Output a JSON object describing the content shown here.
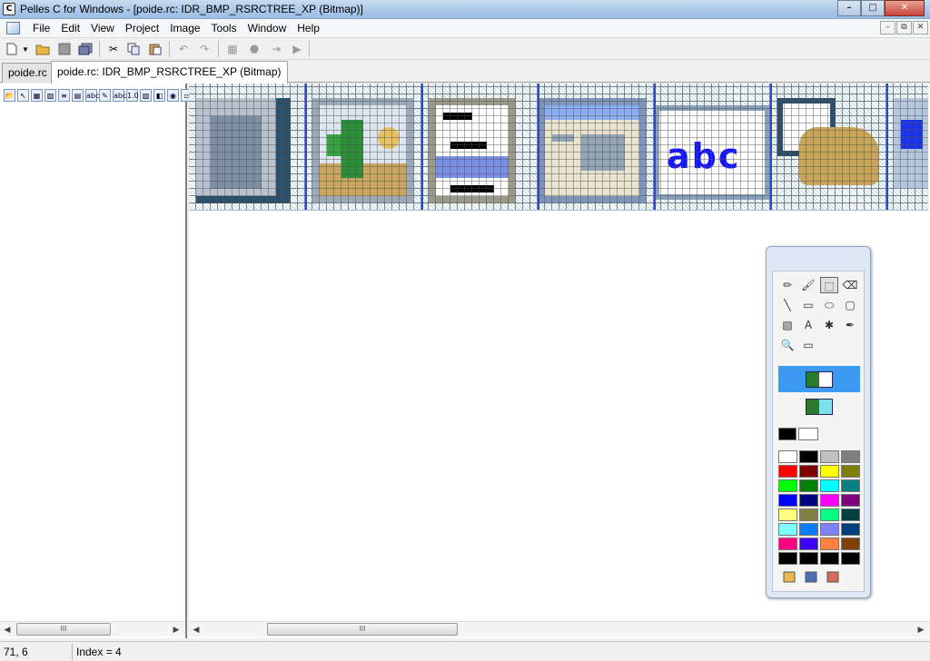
{
  "window": {
    "title": "Pelles C for Windows - [poide.rc: IDR_BMP_RSRCTREE_XP (Bitmap)]",
    "app_icon": "C",
    "controls": {
      "minimize": "–",
      "maximize": "□",
      "close": "✕"
    }
  },
  "menu": {
    "items": [
      "File",
      "Edit",
      "View",
      "Project",
      "Image",
      "Tools",
      "Window",
      "Help"
    ],
    "mdi": {
      "minimize": "–",
      "restore": "⧉",
      "close": "✕"
    }
  },
  "toolbar": {
    "icons": [
      "new-icon",
      "dropdown-icon",
      "open-icon",
      "save-icon",
      "save-all-icon",
      "cut-icon",
      "copy-icon",
      "paste-icon",
      "undo-icon",
      "redo-icon",
      "build-icon",
      "stop-icon",
      "debug-icon",
      "run-icon"
    ]
  },
  "tabs": [
    {
      "label": "poide.rc",
      "active": false
    },
    {
      "label": "poide.rc: IDR_BMP_RSRCTREE_XP (Bitmap)",
      "active": true
    }
  ],
  "resource_tree": {
    "icons": [
      {
        "name": "folder-open-icon",
        "glyph": "📂"
      },
      {
        "name": "cursor-icon",
        "glyph": "↖"
      },
      {
        "name": "bitmap-icon",
        "glyph": "▦"
      },
      {
        "name": "image-icon",
        "glyph": "▧"
      },
      {
        "name": "menu-icon",
        "glyph": "≡"
      },
      {
        "name": "dialog-icon",
        "glyph": "▤"
      },
      {
        "name": "string-table-icon",
        "glyph": "abc"
      },
      {
        "name": "accelerator-icon",
        "glyph": "✎"
      },
      {
        "name": "stringtable-abc-icon",
        "glyph": "abc"
      },
      {
        "name": "version-icon",
        "glyph": "1.0"
      },
      {
        "name": "manifest-icon",
        "glyph": "▨"
      },
      {
        "name": "toolbar-resource-icon",
        "glyph": "◧"
      },
      {
        "name": "rcdata-icon",
        "glyph": "◉"
      },
      {
        "name": "file-icon",
        "glyph": "▫"
      }
    ],
    "scroll_thumb": "III"
  },
  "palette": {
    "tools": [
      {
        "name": "pencil-tool-icon",
        "glyph": "✏"
      },
      {
        "name": "brush-tool-icon",
        "glyph": "🖌"
      },
      {
        "name": "select-tool-icon",
        "glyph": "⬚",
        "selected": true
      },
      {
        "name": "eraser-tool-icon",
        "glyph": "⌫"
      },
      {
        "name": "line-tool-icon",
        "glyph": "╲"
      },
      {
        "name": "rectangle-tool-icon",
        "glyph": "▭"
      },
      {
        "name": "ellipse-tool-icon",
        "glyph": "⬭"
      },
      {
        "name": "rounded-rect-tool-icon",
        "glyph": "▢"
      },
      {
        "name": "fill-tool-icon",
        "glyph": "▧"
      },
      {
        "name": "text-tool-icon",
        "glyph": "A"
      },
      {
        "name": "hotspot-tool-icon",
        "glyph": "✱"
      },
      {
        "name": "color-picker-tool-icon",
        "glyph": "✒"
      },
      {
        "name": "zoom-tool-icon",
        "glyph": "🔍"
      },
      {
        "name": "rect-select-tool-icon",
        "glyph": "▭"
      }
    ],
    "foreground": "#000000",
    "background": "#ffffff",
    "colors": [
      "#ffffff",
      "#000000",
      "#c0c0c0",
      "#808080",
      "#ff0000",
      "#800000",
      "#ffff00",
      "#808000",
      "#00ff00",
      "#008000",
      "#00ffff",
      "#008080",
      "#0000ff",
      "#000080",
      "#ff00ff",
      "#800080",
      "#ffff80",
      "#808040",
      "#00ff80",
      "#004040",
      "#80ffff",
      "#0080ff",
      "#8080ff",
      "#004080",
      "#ff0080",
      "#4000ff",
      "#ff8040",
      "#804000",
      "#000000",
      "#000000",
      "#000000",
      "#000000"
    ],
    "bottom_icons": [
      "open-palette-icon",
      "save-palette-icon",
      "default-palette-icon"
    ]
  },
  "canvas": {
    "hscroll_thumb": "III"
  },
  "status": {
    "coords": "71, 6",
    "index": "Index = 4"
  }
}
